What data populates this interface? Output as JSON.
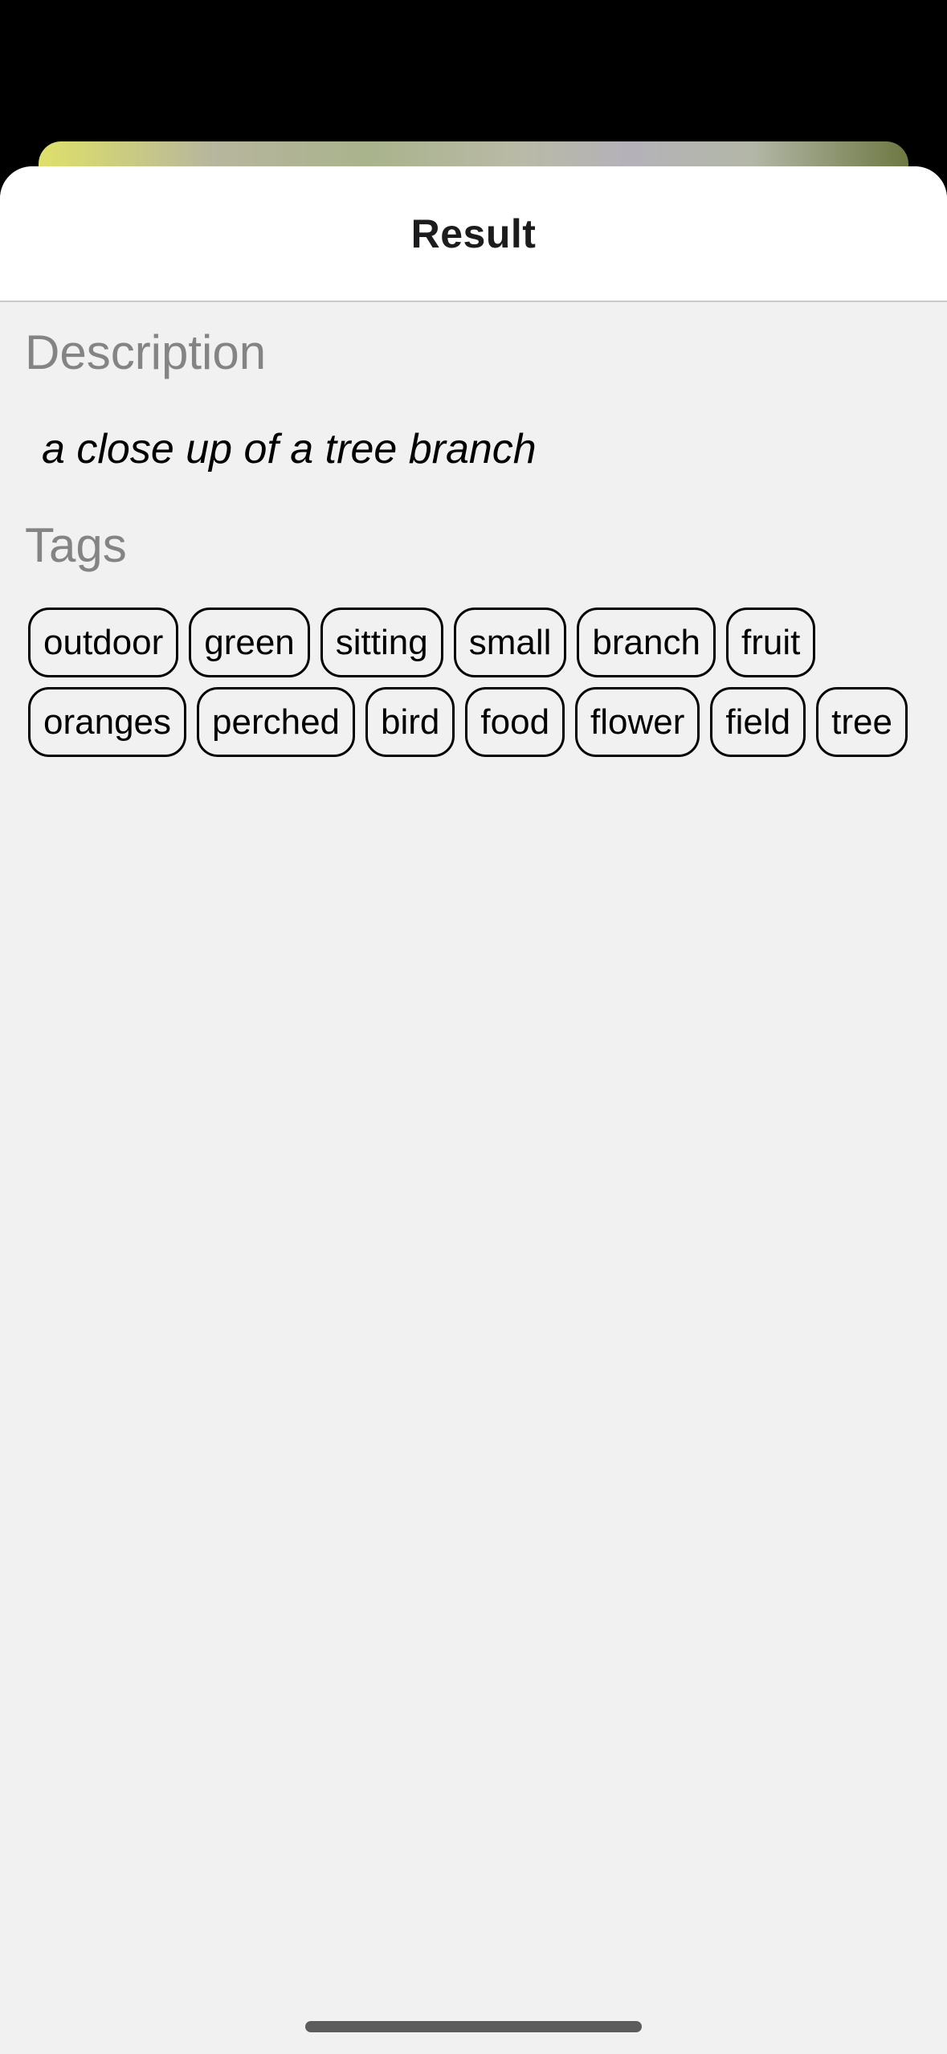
{
  "sheet": {
    "title": "Result"
  },
  "description": {
    "label": "Description",
    "text": "a close up of a tree branch"
  },
  "tags": {
    "label": "Tags",
    "row1": [
      "outdoor",
      "green",
      "sitting",
      "small",
      "branch",
      "fruit"
    ],
    "row2": [
      "oranges",
      "perched",
      "bird",
      "food",
      "flower",
      "field",
      "tree"
    ]
  },
  "colors": {
    "sheet_background": "#f1f1f1",
    "header_background": "#ffffff",
    "label_gray": "#848484",
    "tag_border": "#000000"
  }
}
